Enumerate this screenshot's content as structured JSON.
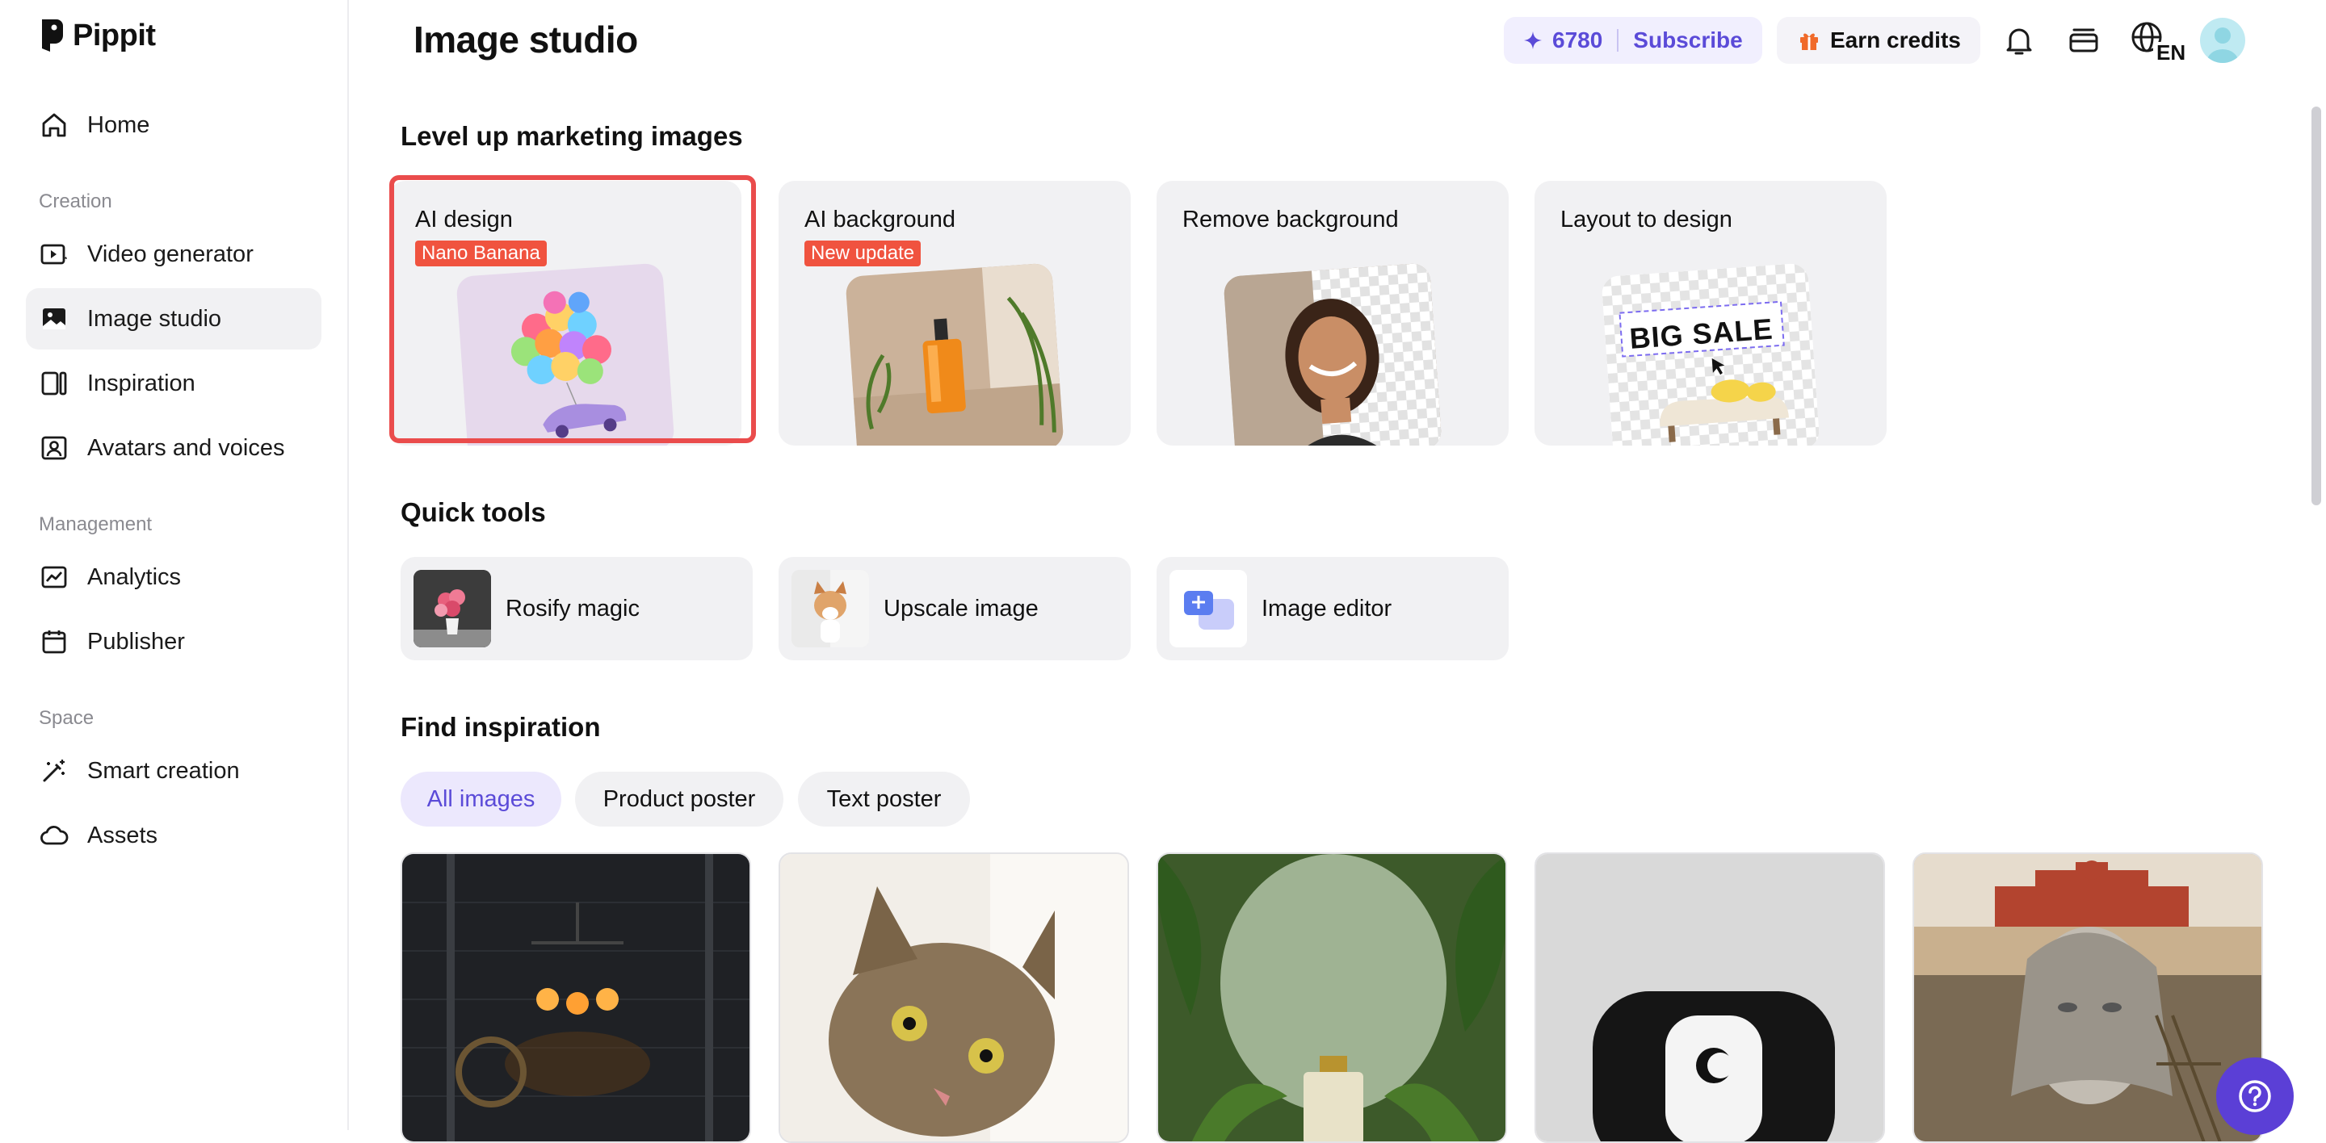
{
  "app": {
    "name": "Pippit"
  },
  "sidebar": {
    "home": "Home",
    "sections": {
      "creation": "Creation",
      "management": "Management",
      "space": "Space"
    },
    "creation_items": [
      "Video generator",
      "Image studio",
      "Inspiration",
      "Avatars and voices"
    ],
    "management_items": [
      "Analytics",
      "Publisher"
    ],
    "space_items": [
      "Smart creation",
      "Assets"
    ],
    "active_item": "Image studio"
  },
  "header": {
    "title": "Image studio",
    "credits": "6780",
    "subscribe": "Subscribe",
    "earn_credits": "Earn credits",
    "language": "EN"
  },
  "marketing": {
    "heading": "Level up marketing images",
    "cards": [
      {
        "title": "AI design",
        "badge": "Nano Banana",
        "selected": true
      },
      {
        "title": "AI background",
        "badge": "New update"
      },
      {
        "title": "Remove background"
      },
      {
        "title": "Layout to design",
        "art_text": "BIG SALE"
      }
    ]
  },
  "quick_tools": {
    "heading": "Quick tools",
    "items": [
      "Rosify magic",
      "Upscale image",
      "Image editor"
    ]
  },
  "inspiration": {
    "heading": "Find inspiration",
    "filters": [
      "All images",
      "Product poster",
      "Text poster"
    ],
    "active_filter": "All images"
  },
  "colors": {
    "accent": "#5b4bd8",
    "badge": "#f0533f",
    "selection": "#ea4c4c"
  }
}
